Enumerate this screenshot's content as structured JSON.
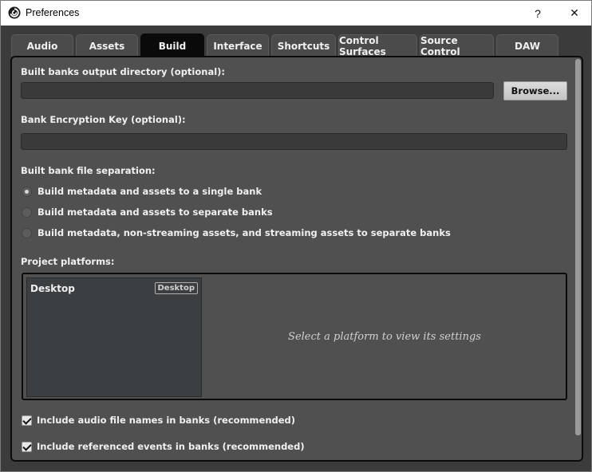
{
  "window": {
    "title": "Preferences",
    "help_glyph": "?",
    "close_glyph": "✕",
    "icon": "fmod-logo-icon"
  },
  "tabs": [
    {
      "label": "Audio"
    },
    {
      "label": "Assets"
    },
    {
      "label": "Build",
      "active": true
    },
    {
      "label": "Interface"
    },
    {
      "label": "Shortcuts"
    },
    {
      "label": "Control Surfaces"
    },
    {
      "label": "Source Control"
    },
    {
      "label": "DAW"
    }
  ],
  "build": {
    "output_dir_label": "Built banks output directory (optional):",
    "output_dir_value": "",
    "browse_label": "Browse...",
    "encryption_label": "Bank Encryption Key (optional):",
    "encryption_value": "",
    "separation_label": "Built bank file separation:",
    "separation_options": [
      {
        "label": "Build metadata and assets to a single bank",
        "checked": true
      },
      {
        "label": "Build metadata and assets to separate banks",
        "checked": false
      },
      {
        "label": "Build metadata, non-streaming assets, and streaming assets to separate banks",
        "checked": false
      }
    ],
    "platforms_label": "Project platforms:",
    "platforms": [
      {
        "name": "Desktop",
        "tag": "Desktop"
      }
    ],
    "platform_hint": "Select a platform to view its settings",
    "include_filenames_label": "Include audio file names in banks (recommended)",
    "include_filenames_checked": true,
    "include_events_label": "Include referenced events in banks (recommended)",
    "include_events_checked": true
  },
  "colors": {
    "background": "#3b3b3b",
    "panel": "#505050",
    "active_tab": "#0a0a0a"
  }
}
